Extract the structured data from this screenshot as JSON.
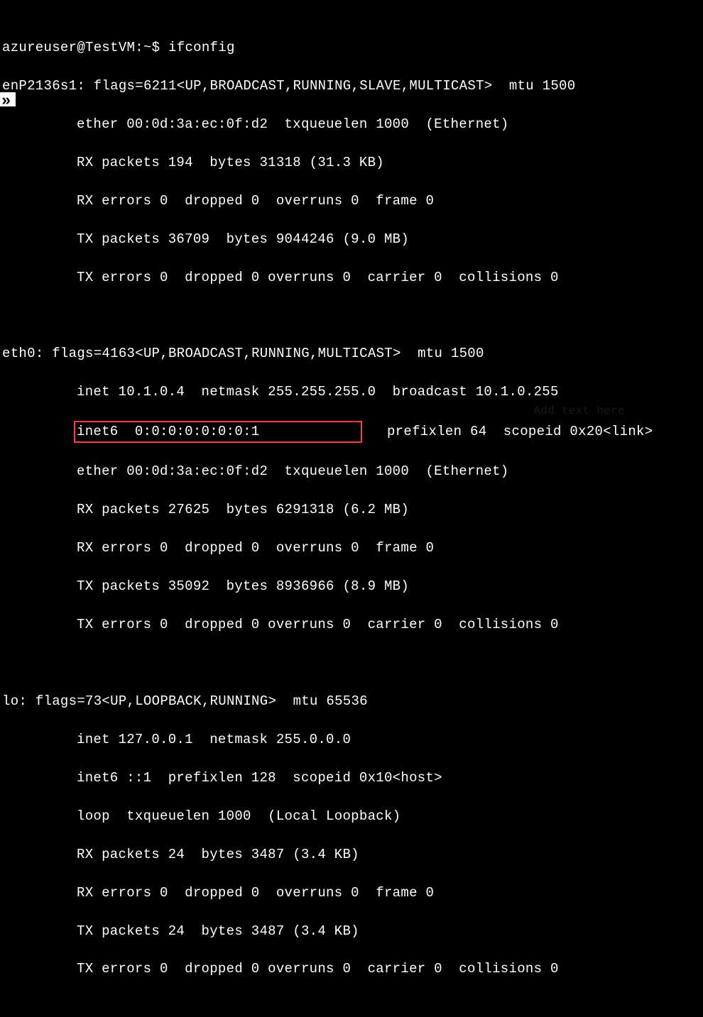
{
  "prompt": {
    "user_host": "azureuser@TestVM",
    "cwd": "~",
    "command": "ifconfig"
  },
  "interfaces": [
    {
      "name": "enP2136s1",
      "flags_line": "flags=6211<UP,BROADCAST,RUNNING,SLAVE,MULTICAST>  mtu 1500",
      "lines": [
        "ether 00:0d:3a:ec:0f:d2  txqueuelen 1000  (Ethernet)",
        "RX packets 194  bytes 31318 (31.3 KB)",
        "RX errors 0  dropped 0  overruns 0  frame 0",
        "TX packets 36709  bytes 9044246 (9.0 MB)",
        "TX errors 0  dropped 0 overruns 0  carrier 0  collisions 0"
      ]
    },
    {
      "name": "eth0",
      "flags_line": "flags=4163<UP,BROADCAST,RUNNING,MULTICAST>  mtu 1500",
      "lines_before_highlight": [
        "inet 10.1.0.4  netmask 255.255.255.0  broadcast 10.1.0.255"
      ],
      "highlight_text": "inet6  0:0:0:0:0:0:0:1            ",
      "highlight_suffix": "   prefixlen 64  scopeid 0x20<link>",
      "lines_after_highlight": [
        "ether 00:0d:3a:ec:0f:d2  txqueuelen 1000  (Ethernet)",
        "RX packets 27625  bytes 6291318 (6.2 MB)",
        "RX errors 0  dropped 0  overruns 0  frame 0",
        "TX packets 35092  bytes 8936966 (8.9 MB)",
        "TX errors 0  dropped 0 overruns 0  carrier 0  collisions 0"
      ]
    },
    {
      "name": "lo",
      "flags_line": "flags=73<UP,LOOPBACK,RUNNING>  mtu 65536",
      "lines": [
        "inet 127.0.0.1  netmask 255.0.0.0",
        "inet6 ::1  prefixlen 128  scopeid 0x10<host>",
        "loop  txqueuelen 1000  (Local Loopback)",
        "RX packets 24  bytes 3487 (3.4 KB)",
        "RX errors 0  dropped 0  overruns 0  frame 0",
        "TX packets 24  bytes 3487 (3.4 KB)",
        "TX errors 0  dropped 0 overruns 0  carrier 0  collisions 0"
      ]
    }
  ],
  "ghost": "Add text here"
}
